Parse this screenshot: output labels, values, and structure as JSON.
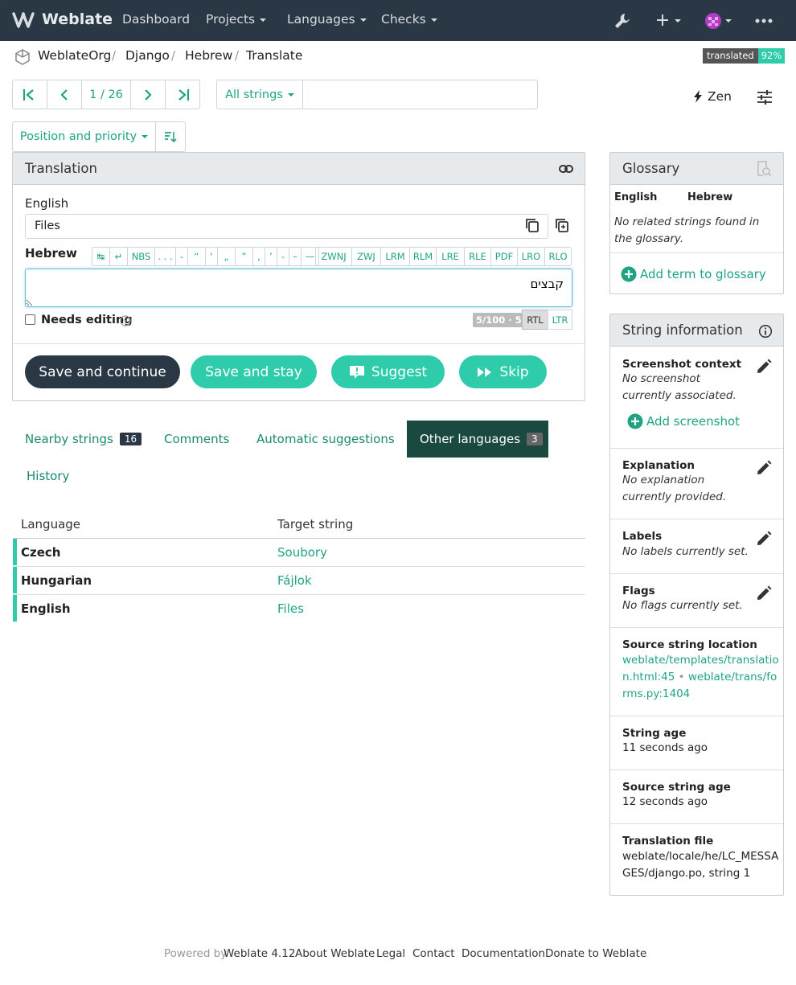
{
  "navbar": {
    "brand": "Weblate",
    "dashboard": "Dashboard",
    "projects": "Projects",
    "languages": "Languages",
    "checks": "Checks"
  },
  "breadcrumb": {
    "org": "WeblateOrg",
    "project": "Django",
    "language": "Hebrew",
    "page": "Translate"
  },
  "status": {
    "label": "translated",
    "percent": "92%"
  },
  "pager": {
    "position": "1 / 26"
  },
  "filter": {
    "strings": "All strings",
    "search_value": "",
    "sort": "Position and priority",
    "zen": "Zen"
  },
  "translation": {
    "title": "Translation",
    "source_lang": "English",
    "source_text": "Files",
    "target_lang": "Hebrew",
    "target_text": "קבצים",
    "needs_editing": "Needs editing",
    "counter": "5/100 · 5",
    "rtl": "RTL",
    "ltr": "LTR",
    "chars1": [
      "↹",
      "↵",
      "NBS",
      ". . .",
      "‑",
      "“",
      "‘",
      "„",
      "”",
      ",",
      "’",
      "-",
      "–",
      "—"
    ],
    "chars2": [
      "ZWNJ",
      "ZWJ",
      "LRM",
      "RLM",
      "LRE",
      "RLE",
      "PDF",
      "LRO",
      "RLO"
    ]
  },
  "actions": {
    "save_continue": "Save and continue",
    "save_stay": "Save and stay",
    "suggest": "Suggest",
    "skip": "Skip"
  },
  "tabs": {
    "nearby": "Nearby strings",
    "nearby_count": "16",
    "comments": "Comments",
    "automatic": "Automatic suggestions",
    "other": "Other languages",
    "other_count": "3",
    "history": "History"
  },
  "other_languages": {
    "col_language": "Language",
    "col_target": "Target string",
    "rows": [
      {
        "language": "Czech",
        "target": "Soubory"
      },
      {
        "language": "Hungarian",
        "target": "Fájlok"
      },
      {
        "language": "English",
        "target": "Files"
      }
    ]
  },
  "glossary": {
    "title": "Glossary",
    "col_source": "English",
    "col_target": "Hebrew",
    "empty": "No related strings found in the glossary.",
    "add": "Add term to glossary"
  },
  "string_info": {
    "title": "String information",
    "screenshot_title": "Screenshot context",
    "screenshot_value": "No screenshot currently associated.",
    "add_screenshot": "Add screenshot",
    "explanation_title": "Explanation",
    "explanation_value": "No explanation currently provided.",
    "labels_title": "Labels",
    "labels_value": "No labels currently set.",
    "flags_title": "Flags",
    "flags_value": "No flags currently set.",
    "location_title": "Source string location",
    "location_1": "weblate/templates/translation.html:45",
    "location_2": "weblate/trans/forms.py:1404",
    "age_title": "String age",
    "age_value": "11 seconds ago",
    "source_age_title": "Source string age",
    "source_age_value": "12 seconds ago",
    "file_title": "Translation file",
    "file_value": "weblate/locale/he/LC_MESSAGES/django.po, string 1"
  },
  "footer": {
    "powered": "Powered by",
    "version": "Weblate 4.12",
    "about": "About Weblate",
    "legal": "Legal",
    "contact": "Contact",
    "docs": "Documentation",
    "donate": "Donate to Weblate"
  },
  "colors": {
    "accent": "#1fa385",
    "navbar": "#2a3744",
    "progress": "#2eccaa"
  }
}
